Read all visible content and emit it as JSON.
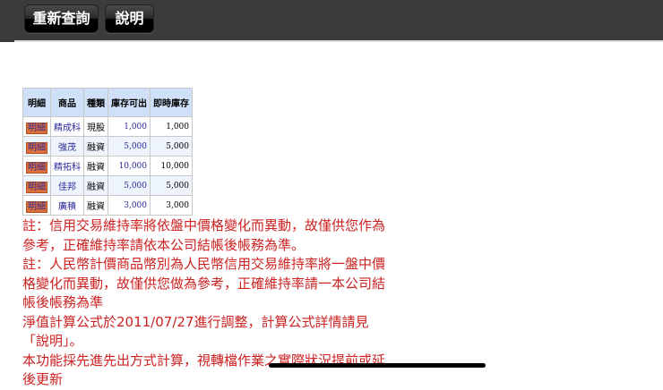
{
  "toolbar": {
    "requery_label": "重新查詢",
    "help_label": "說明"
  },
  "table": {
    "headers": [
      "明細",
      "商品",
      "種類",
      "庫存可出",
      "即時庫存"
    ],
    "rows": [
      {
        "detail": "明細",
        "product": "精成科",
        "type": "現股",
        "available": "1,000",
        "realtime": "1,000"
      },
      {
        "detail": "明細",
        "product": "強茂",
        "type": "融資",
        "available": "5,000",
        "realtime": "5,000"
      },
      {
        "detail": "明細",
        "product": "精拓科",
        "type": "融資",
        "available": "10,000",
        "realtime": "10,000"
      },
      {
        "detail": "明細",
        "product": "佳邦",
        "type": "融資",
        "available": "5,000",
        "realtime": "5,000"
      },
      {
        "detail": "明細",
        "product": "廣積",
        "type": "融資",
        "available": "3,000",
        "realtime": "3,000"
      }
    ]
  },
  "notes": [
    "註：信用交易維持率將依盤中價格變化而異動，故僅供您作為參考，正確維持率請依本公司結帳後帳務為準。",
    "註：人民幣計價商品幣別為人民幣信用交易維持率將一盤中價格變化而異動，故僅供您做為參考，正確維持率請一本公司結帳後帳務為準",
    "淨值計算公式於2011/07/27進行調整，計算公式詳情請見「說明」。",
    "本功能採先進先出方式計算，視轉檔作業之實際狀況提前或延後更新"
  ]
}
